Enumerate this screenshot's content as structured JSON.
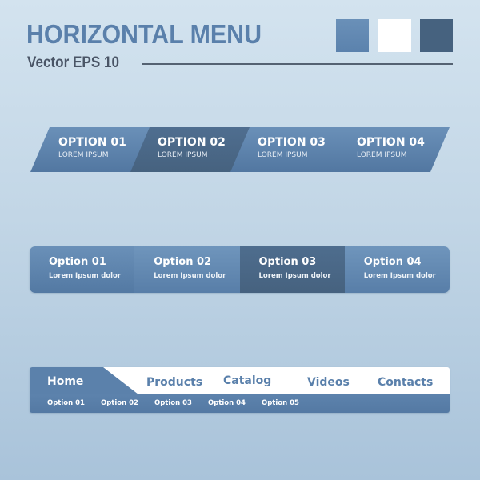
{
  "header": {
    "title": "HORIZONTAL MENU",
    "subtitle": "Vector EPS 10"
  },
  "palette": {
    "swatches": [
      {
        "name": "medium-blue",
        "color": "#5b82ad"
      },
      {
        "name": "white",
        "color": "#ffffff"
      },
      {
        "name": "dark-blue",
        "color": "#46627f"
      }
    ]
  },
  "menu1": {
    "style": "slanted",
    "active_index": 1,
    "items": [
      {
        "label": "OPTION 01",
        "sub": "LOREM IPSUM"
      },
      {
        "label": "OPTION 02",
        "sub": "LOREM IPSUM"
      },
      {
        "label": "OPTION 03",
        "sub": "LOREM IPSUM"
      },
      {
        "label": "OPTION 04",
        "sub": "LOREM IPSUM"
      }
    ]
  },
  "menu2": {
    "style": "rounded-segmented",
    "active_index": 2,
    "items": [
      {
        "label": "Option 01",
        "sub": "Lorem Ipsum dolor"
      },
      {
        "label": "Option 02",
        "sub": "Lorem Ipsum dolor"
      },
      {
        "label": "Option 03",
        "sub": "Lorem Ipsum dolor"
      },
      {
        "label": "Option 04",
        "sub": "Lorem Ipsum dolor"
      }
    ]
  },
  "menu3": {
    "style": "tabbed",
    "active_tab": "Home",
    "tabs": [
      "Home",
      "Products",
      "Catalog",
      "Videos",
      "Contacts"
    ],
    "subitems": [
      "Option 01",
      "Option 02",
      "Option 03",
      "Option 04",
      "Option 05"
    ]
  },
  "colors": {
    "accent": "#5a80ab",
    "active_dark": "#46627f",
    "text_dark": "#4a5566",
    "white": "#ffffff"
  }
}
